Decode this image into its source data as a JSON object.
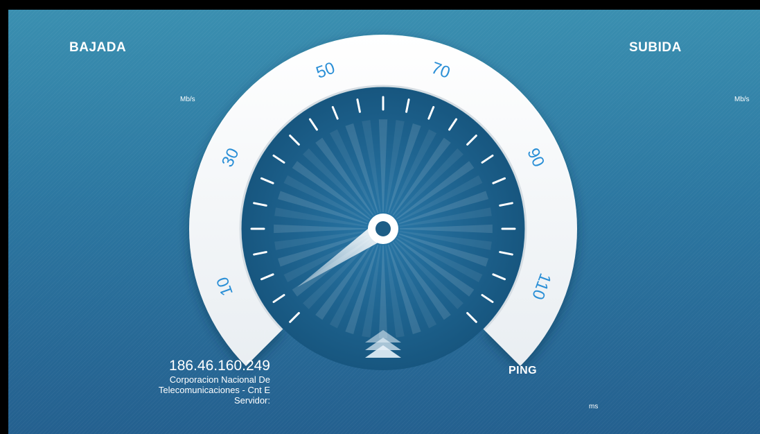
{
  "download": {
    "title": "BAJADA",
    "unit": "Mb/s"
  },
  "upload": {
    "title": "SUBIDA",
    "unit": "Mb/s"
  },
  "gauge": {
    "tick_labels": [
      "10",
      "30",
      "50",
      "70",
      "90",
      "110"
    ],
    "needle_value_fraction": 0.04
  },
  "ping": {
    "title": "PING",
    "unit": "ms"
  },
  "server": {
    "ip": "186.46.160.249",
    "isp_line1": "Corporacion Nacional De",
    "isp_line2": "Telecomunicaciones - Cnt E",
    "label": "Servidor:"
  },
  "colors": {
    "background_top": "#3a8fb0",
    "background_bottom": "#24608f",
    "dial_face": "#1d5d86",
    "ring": "#ffffff",
    "tick_label": "#2a8fd6",
    "needle": "#ffffff"
  },
  "icons": {
    "direction_indicator": "triple-chevron-up-icon"
  }
}
